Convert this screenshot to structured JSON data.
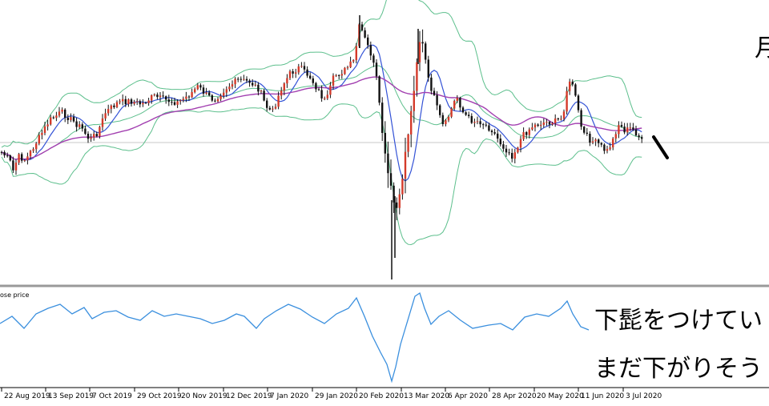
{
  "annotations": {
    "top": "月",
    "mid": "下髭をつけてい",
    "bot": "まだ下がりそう"
  },
  "indicator_label": "ose price",
  "colors": {
    "candle_up": "#d43a2a",
    "candle_down": "#111111",
    "bollinger": "#5cbf8c",
    "ma_fast": "#3352d6",
    "ma_slow": "#a23fb0",
    "indicator": "#3a8fde",
    "separator": "#9a9a9a",
    "hline": "#c8c8c8"
  },
  "chart_data": [
    {
      "type": "candlestick",
      "x": [
        "22 Aug 2019",
        "13 Sep 2019",
        "7 Oct 2019",
        "29 Oct 2019",
        "20 Nov 2019",
        "12 Dec 2019",
        "7 Jan 2020",
        "29 Jan 2020",
        "20 Feb 2020",
        "13 Mar 2020",
        "6 Apr 2020",
        "28 Apr 2020",
        "20 May 2020",
        "11 Jun 2020",
        "3 Jul 2020"
      ],
      "series": [
        {
          "kind": "close",
          "values": [
            158,
            138,
            134,
            126,
            118,
            104,
            92,
            95,
            130,
            170,
            140,
            160,
            158,
            175,
            178
          ]
        },
        {
          "kind": "close",
          "values": [
            148,
            142,
            131,
            124,
            121,
            102,
            84,
            70,
            200,
            125,
            152,
            188,
            108,
            168,
            172
          ]
        },
        {
          "kind": "close",
          "values": [
            165,
            146,
            130,
            127,
            123,
            100,
            86,
            30,
            245,
            90,
            160,
            185,
            100,
            177,
            180
          ]
        },
        {
          "kind": "close",
          "values": [
            180,
            130,
            122,
            128,
            120,
            98,
            90,
            42,
            295,
            70,
            165,
            195,
            122,
            182,
            182
          ]
        }
      ]
    },
    {
      "type": "line",
      "x": [
        "22 Aug 2019",
        "13 Sep 2019",
        "7 Oct 2019",
        "29 Oct 2019",
        "20 Nov 2019",
        "12 Dec 2019",
        "7 Jan 2020",
        "29 Jan 2020",
        "20 Feb 2020",
        "13 Mar 2020",
        "6 Apr 2020",
        "28 Apr 2020",
        "20 May 2020",
        "11 Jun 2020",
        "3 Jul 2020"
      ],
      "series": [
        {
          "values": [
            404,
            385,
            392,
            398,
            400,
            402,
            398,
            400,
            470,
            372,
            410,
            415,
            378,
            410,
            405
          ]
        }
      ]
    }
  ]
}
